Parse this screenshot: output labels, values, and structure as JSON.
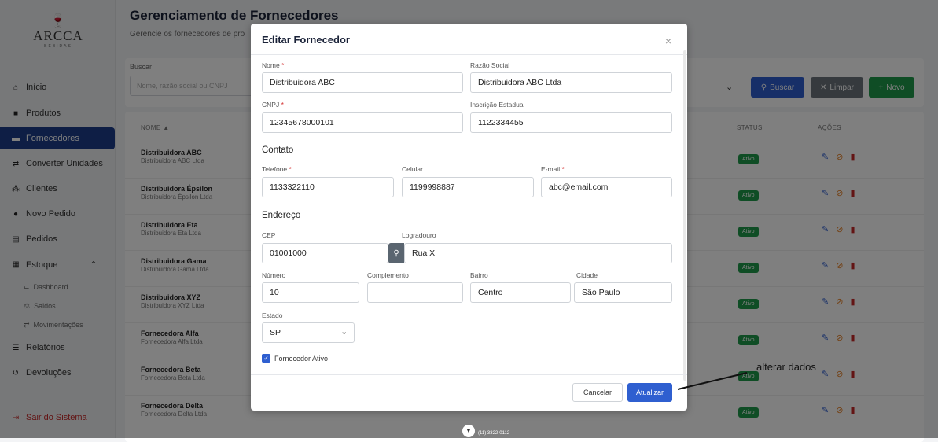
{
  "sidebar": {
    "brand": "ARCCA",
    "brand_sub": "BEBIDAS",
    "items": [
      {
        "label": "Início",
        "icon": "home-icon"
      },
      {
        "label": "Produtos",
        "icon": "box-icon"
      },
      {
        "label": "Fornecedores",
        "icon": "truck-icon"
      },
      {
        "label": "Converter Unidades",
        "icon": "swap-icon"
      },
      {
        "label": "Clientes",
        "icon": "users-icon"
      },
      {
        "label": "Novo Pedido",
        "icon": "plus-circle-icon"
      },
      {
        "label": "Pedidos",
        "icon": "cart-icon"
      },
      {
        "label": "Estoque",
        "icon": "warehouse-icon"
      },
      {
        "label": "Relatórios",
        "icon": "report-icon"
      },
      {
        "label": "Devoluções",
        "icon": "undo-icon"
      }
    ],
    "estoque_sub": [
      "Dashboard",
      "Saldos",
      "Movimentações"
    ],
    "logout": "Sair do Sistema",
    "active_color": "#1c3d8a"
  },
  "main": {
    "title": "Gerenciamento de Fornecedores",
    "subtitle": "Gerencie os fornecedores de pro",
    "search_label": "Buscar",
    "search_placeholder": "Nome, razão social ou CNPJ",
    "btn_buscar": "Buscar",
    "btn_limpar": "Limpar",
    "btn_novo": "Novo",
    "columns": {
      "nome": "NOME",
      "status": "STATUS",
      "acoes": "AÇÕES"
    },
    "rows": [
      {
        "nome": "Distribuidora ABC",
        "razao": "Distribuidora ABC Ltda",
        "status": "Ativo"
      },
      {
        "nome": "Distribuidora Épsilon",
        "razao": "Distribuidora Épsilon Ltda",
        "status": "Ativo"
      },
      {
        "nome": "Distribuidora Eta",
        "razao": "Distribuidora Eta Ltda",
        "status": "Ativo"
      },
      {
        "nome": "Distribuidora Gama",
        "razao": "Distribuidora Gama Ltda",
        "status": "Ativo"
      },
      {
        "nome": "Distribuidora XYZ",
        "razao": "Distribuidora XYZ Ltda",
        "status": "Ativo"
      },
      {
        "nome": "Fornecedora Alfa",
        "razao": "Fornecedora Alfa Ltda",
        "status": "Ativo"
      },
      {
        "nome": "Fornecedora Beta",
        "razao": "Fornecedora Beta Ltda",
        "status": "Ativo"
      },
      {
        "nome": "Fornecedora Delta",
        "razao": "Fornecedora Delta Ltda",
        "status": "Ativo"
      }
    ]
  },
  "modal": {
    "title": "Editar Fornecedor",
    "close": "×",
    "nome_label": "Nome",
    "nome": "Distribuidora ABC",
    "razao_label": "Razão Social",
    "razao": "Distribuidora ABC Ltda",
    "cnpj_label": "CNPJ",
    "cnpj": "12345678000101",
    "ie_label": "Inscrição Estadual",
    "ie": "1122334455",
    "contato": "Contato",
    "telefone_label": "Telefone",
    "telefone": "1133322110",
    "celular_label": "Celular",
    "celular": "1199998887",
    "email_label": "E-mail",
    "email": "abc@email.com",
    "endereco": "Endereço",
    "cep_label": "CEP",
    "cep": "01001000",
    "logradouro_label": "Logradouro",
    "logradouro": "Rua X",
    "numero_label": "Número",
    "numero": "10",
    "complemento_label": "Complemento",
    "complemento": "",
    "bairro_label": "Bairro",
    "bairro": "Centro",
    "cidade_label": "Cidade",
    "cidade": "São Paulo",
    "estado_label": "Estado",
    "estado": "SP",
    "ativo_label": "Fornecedor Ativo",
    "cancelar": "Cancelar",
    "atualizar": "Atualizar"
  },
  "annotation": "alterar dados",
  "footer_text": "(11) 3322-0112"
}
